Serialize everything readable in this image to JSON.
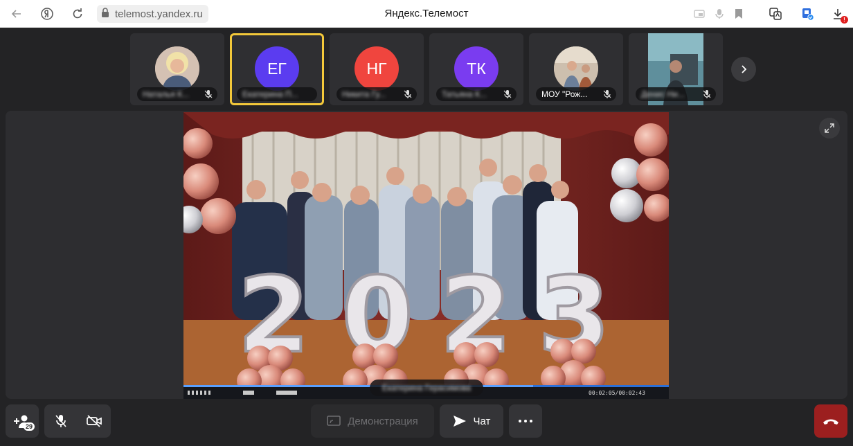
{
  "browser": {
    "url": "telemost.yandex.ru",
    "title": "Яндекс.Телемост",
    "download_badge": "!"
  },
  "participants": [
    {
      "name": "Наталья К...",
      "initials": "",
      "type": "photo",
      "muted": true,
      "active": false
    },
    {
      "name": "Екатерина П...",
      "initials": "ЕГ",
      "type": "initials",
      "color": "#5b3cf0",
      "muted": false,
      "active": true
    },
    {
      "name": "Никита Гу...",
      "initials": "НГ",
      "type": "initials",
      "color": "#f0453e",
      "muted": true,
      "active": false
    },
    {
      "name": "Татьяна К...",
      "initials": "ТК",
      "type": "initials",
      "color": "#7a3cf0",
      "muted": true,
      "active": false
    },
    {
      "name": "МОУ \"Рож...",
      "initials": "",
      "type": "photo",
      "muted": true,
      "active": false
    },
    {
      "name": "Денис Ни...",
      "initials": "",
      "type": "video",
      "muted": true,
      "active": false
    }
  ],
  "stage": {
    "speaker_name": "Екатерина Герасимова",
    "player_time": "00:02:05/00:02:43",
    "balloon_digits": [
      "2",
      "0",
      "2",
      "3"
    ]
  },
  "toolbar": {
    "invite_count": "29",
    "demo_label": "Демонстрация",
    "chat_label": "Чат"
  },
  "colors": {
    "accent_active": "#f3c83a",
    "hangup": "#9c1f1f"
  }
}
